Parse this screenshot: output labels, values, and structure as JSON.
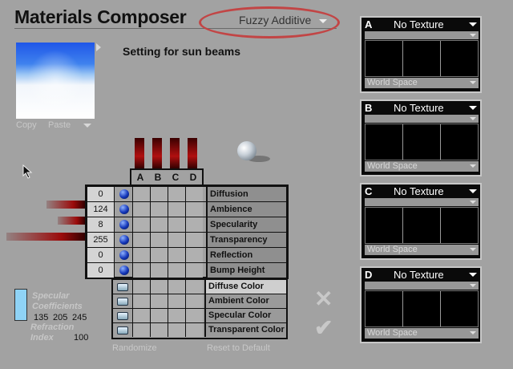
{
  "header": {
    "title": "Materials Composer",
    "blend_mode": "Fuzzy Additive",
    "setting_name": "Setting for sun beams"
  },
  "preview": {
    "copy_label": "Copy",
    "paste_label": "Paste"
  },
  "columns": [
    "A",
    "B",
    "C",
    "D"
  ],
  "properties": [
    {
      "value": "0",
      "label": "Diffusion"
    },
    {
      "value": "124",
      "label": "Ambience"
    },
    {
      "value": "8",
      "label": "Specularity"
    },
    {
      "value": "255",
      "label": "Transparency"
    },
    {
      "value": "0",
      "label": "Reflection"
    },
    {
      "value": "0",
      "label": "Bump Height"
    }
  ],
  "colors": [
    {
      "label": "Diffuse Color"
    },
    {
      "label": "Ambient Color"
    },
    {
      "label": "Specular Color"
    },
    {
      "label": "Transparent Color"
    }
  ],
  "specular": {
    "label_line1": "Specular",
    "label_line2": "Coefficients",
    "r": "135",
    "g": "205",
    "b": "245",
    "swatch_color": "#8fd3f6"
  },
  "refraction": {
    "label_line1": "Refraction",
    "label_line2": "Index",
    "value": "100"
  },
  "actions": {
    "randomize": "Randomize",
    "reset": "Reset to Default"
  },
  "textures": [
    {
      "letter": "A",
      "title": "No Texture",
      "space": "World Space"
    },
    {
      "letter": "B",
      "title": "No Texture",
      "space": "World Space"
    },
    {
      "letter": "C",
      "title": "No Texture",
      "space": "World Space"
    },
    {
      "letter": "D",
      "title": "No Texture",
      "space": "World Space"
    }
  ]
}
